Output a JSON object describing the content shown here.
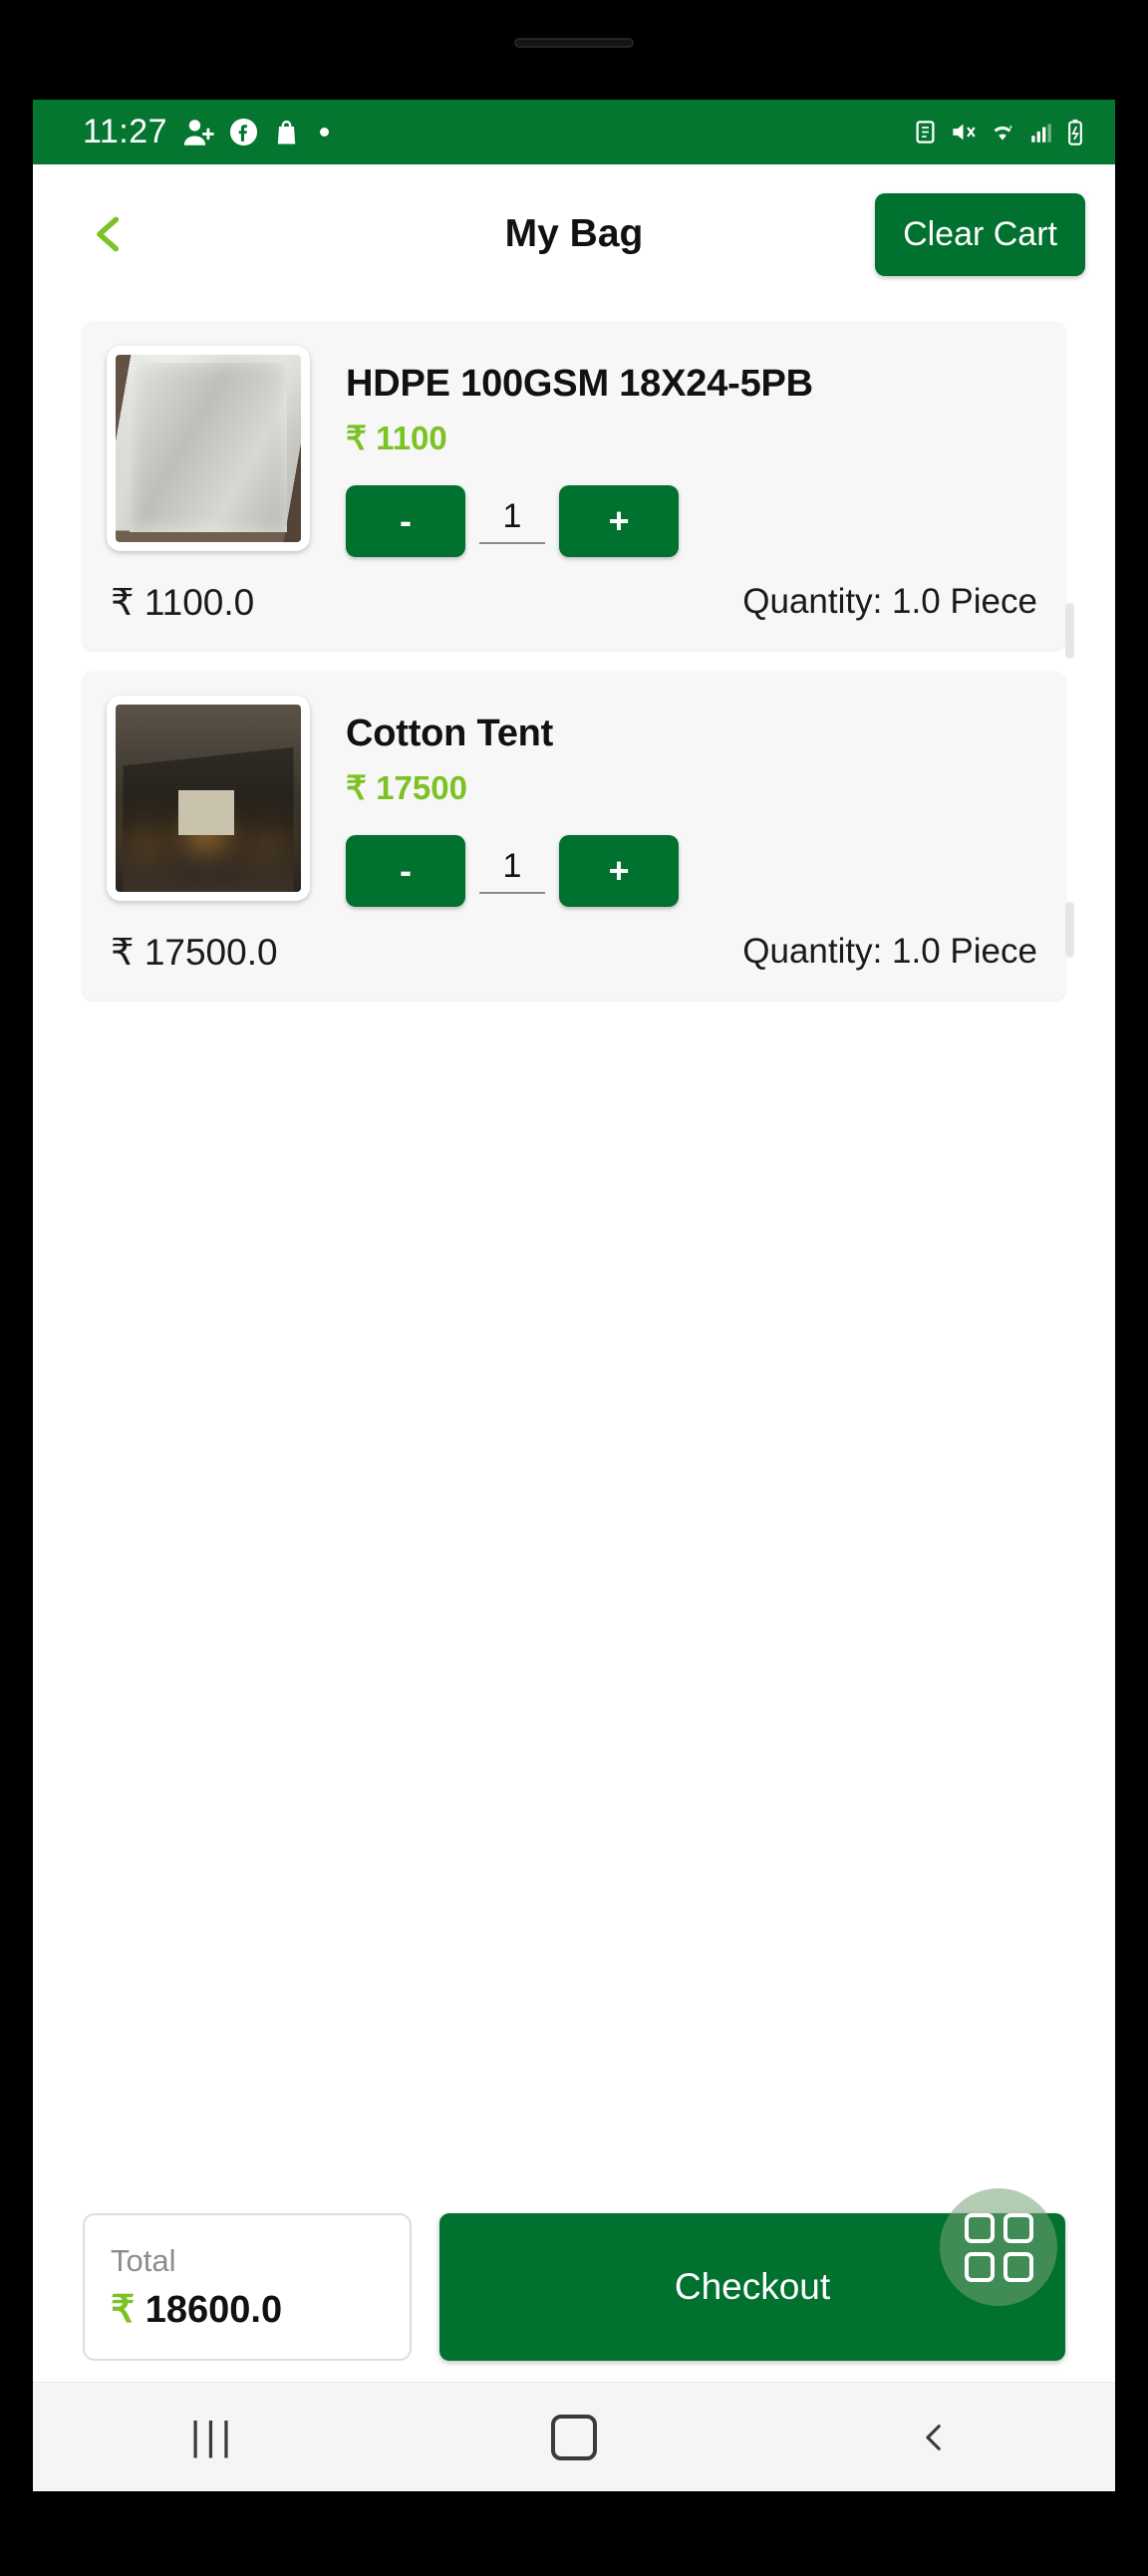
{
  "status_bar": {
    "time": "11:27",
    "left_icons": [
      "person-add-icon",
      "facebook-icon",
      "shopping-bag-icon",
      "dot-indicator-icon"
    ],
    "right_icons": [
      "alarm-icon",
      "mute-icon",
      "wifi-icon",
      "signal-icon",
      "battery-icon"
    ],
    "background_color": "#04762f"
  },
  "app_bar": {
    "back_label": "back-chevron",
    "title": "My Bag",
    "clear_cart_label": "Clear Cart"
  },
  "theme": {
    "primary_green": "#00712f",
    "accent_light_green": "#7cc225",
    "status_green": "#04762f",
    "card_bg": "#f7f7f7"
  },
  "cart": {
    "items": [
      {
        "name": "HDPE 100GSM 18X24-5PB",
        "price": "₹ 1100",
        "decrement_label": "-",
        "increment_label": "+",
        "quantity_value": "1",
        "line_total": "₹ 1100.0",
        "quantity_text": "Quantity:  1.0 Piece",
        "image": "hdpe-tarpaulin-photo"
      },
      {
        "name": "Cotton Tent",
        "price": "₹ 17500",
        "decrement_label": "-",
        "increment_label": "+",
        "quantity_value": "1",
        "line_total": "₹ 17500.0",
        "quantity_text": "Quantity:  1.0 Piece",
        "image": "cotton-tent-photo"
      }
    ]
  },
  "footer": {
    "total_label": "Total",
    "total_currency": "₹",
    "total_amount": "18600.0",
    "checkout_label": "Checkout",
    "fab_label": "grid-menu-icon"
  },
  "nav_bar": {
    "recents_label": "|||",
    "home_label": "home-square-icon",
    "back_label": "back-chevron-icon"
  }
}
